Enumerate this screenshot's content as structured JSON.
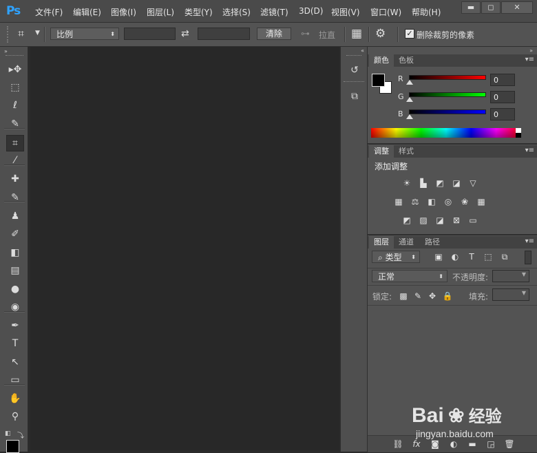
{
  "app": {
    "logo": "Ps"
  },
  "menu": [
    "文件(F)",
    "编辑(E)",
    "图像(I)",
    "图层(L)",
    "类型(Y)",
    "选择(S)",
    "滤镜(T)",
    "3D(D)",
    "视图(V)",
    "窗口(W)",
    "帮助(H)"
  ],
  "window_controls": {
    "minimize": "▬",
    "restore": "◻",
    "close": "✕"
  },
  "options": {
    "ratio_select": "比例",
    "clear_button": "清除",
    "straighten_label": "拉直",
    "delete_cropped_label": "删除裁剪的像素",
    "delete_cropped_checked": true
  },
  "tools": [
    {
      "name": "move-tool",
      "glyph": "▸✥"
    },
    {
      "name": "marquee-tool",
      "glyph": "⬚"
    },
    {
      "name": "lasso-tool",
      "glyph": "ℓ"
    },
    {
      "name": "quick-select-tool",
      "glyph": "✎"
    },
    {
      "name": "crop-tool",
      "glyph": "⌗"
    },
    {
      "name": "eyedropper-tool",
      "glyph": "⁄"
    },
    {
      "name": "healing-brush-tool",
      "glyph": "✚"
    },
    {
      "name": "brush-tool",
      "glyph": "✎"
    },
    {
      "name": "clone-stamp-tool",
      "glyph": "♟"
    },
    {
      "name": "history-brush-tool",
      "glyph": "✐"
    },
    {
      "name": "eraser-tool",
      "glyph": "◧"
    },
    {
      "name": "gradient-tool",
      "glyph": "▤"
    },
    {
      "name": "blur-tool",
      "glyph": "●"
    },
    {
      "name": "dodge-tool",
      "glyph": "◉"
    },
    {
      "name": "pen-tool",
      "glyph": "✒"
    },
    {
      "name": "type-tool",
      "glyph": "T"
    },
    {
      "name": "path-select-tool",
      "glyph": "↖"
    },
    {
      "name": "rectangle-tool",
      "glyph": "▭"
    },
    {
      "name": "hand-tool",
      "glyph": "✋"
    },
    {
      "name": "zoom-tool",
      "glyph": "⚲"
    }
  ],
  "color_panel": {
    "tabs": [
      "颜色",
      "色板"
    ],
    "channels": [
      {
        "label": "R",
        "value": "0",
        "color": "#ff0000"
      },
      {
        "label": "G",
        "value": "0",
        "color": "#00ff00"
      },
      {
        "label": "B",
        "value": "0",
        "color": "#0000ff"
      }
    ]
  },
  "adjust_panel": {
    "tabs": [
      "调整",
      "样式"
    ],
    "title": "添加调整"
  },
  "layers_panel": {
    "tabs": [
      "图层",
      "通道",
      "路径"
    ],
    "filter_select": "类型",
    "blend_mode": "正常",
    "opacity_label": "不透明度:",
    "lock_label": "锁定:",
    "fill_label": "填充:"
  },
  "watermark": {
    "brand": "Bai",
    "brand2": "经验",
    "url": "jingyan.baidu.com"
  }
}
